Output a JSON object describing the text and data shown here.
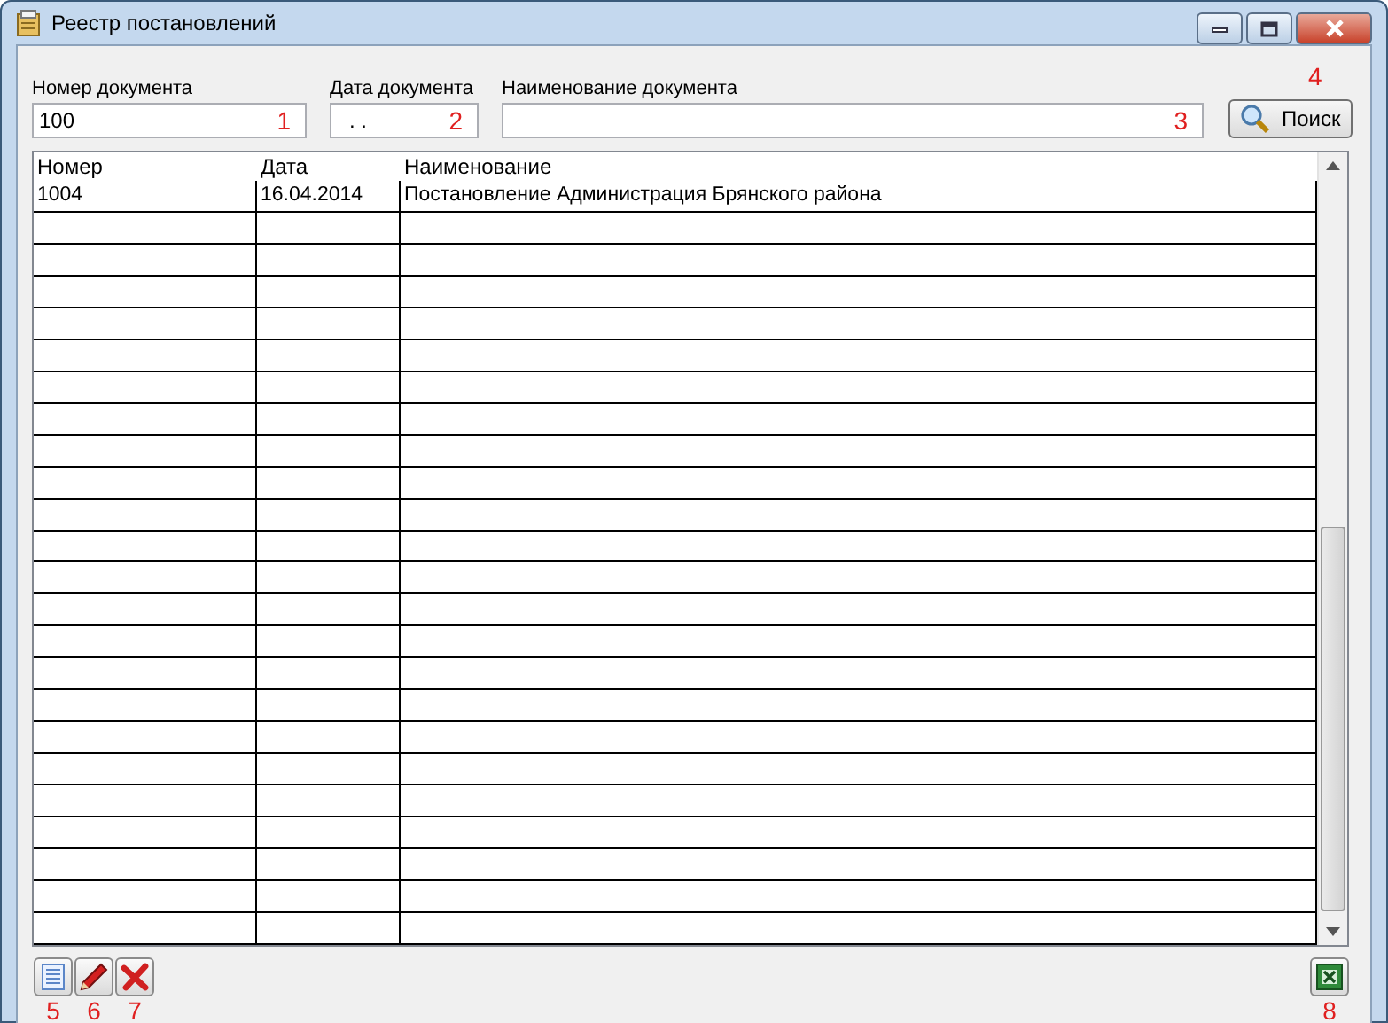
{
  "window": {
    "title": "Реестр постановлений"
  },
  "filters": [
    {
      "label": "Номер документа",
      "value": "100",
      "marker": "1"
    },
    {
      "label": "Дата документа",
      "value": ". .",
      "marker": "2"
    },
    {
      "label": "Наименование документа",
      "marker": "3"
    }
  ],
  "search_button": {
    "label": "Поиск",
    "marker": "4"
  },
  "table": {
    "columns": [
      "Номер",
      "Дата",
      "Наименование"
    ],
    "rows": [
      [
        "1004",
        "16.04.2014",
        "Постановление Администрация Брянского района"
      ]
    ]
  },
  "toolbar": [
    {
      "kind": "add",
      "marker": "5"
    },
    {
      "kind": "edit",
      "marker": "6"
    },
    {
      "kind": "delete",
      "marker": "7"
    }
  ],
  "export_button": {
    "marker": "8"
  }
}
